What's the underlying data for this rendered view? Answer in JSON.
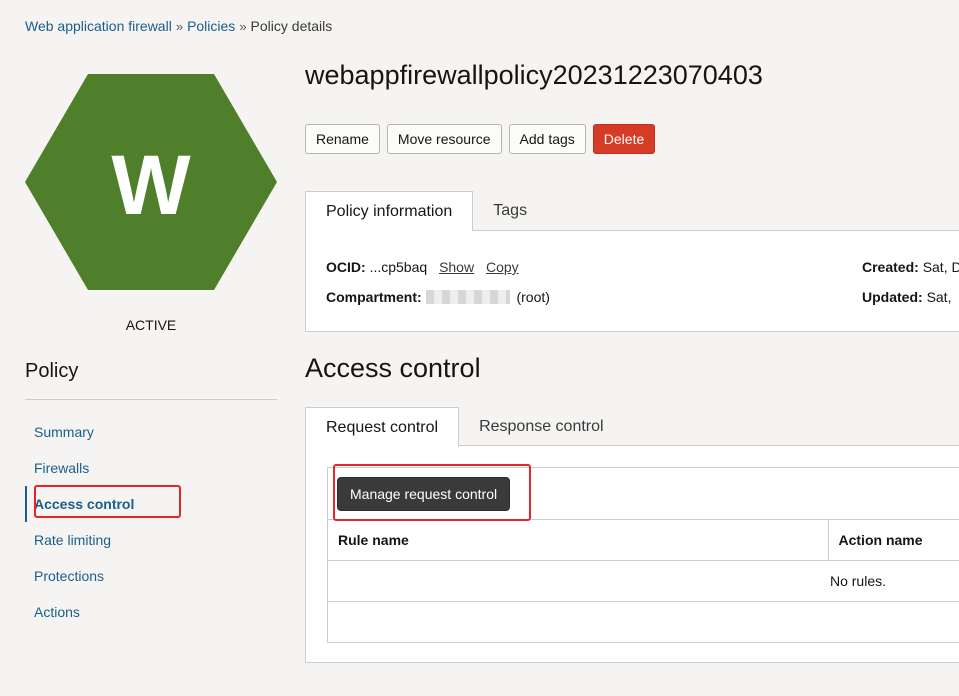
{
  "breadcrumb": {
    "items": [
      "Web application firewall",
      "Policies"
    ],
    "current": "Policy details",
    "separator": "»"
  },
  "resource": {
    "icon_letter": "W",
    "icon_color": "#4f7f2a",
    "status": "ACTIVE"
  },
  "sidebar": {
    "heading": "Policy",
    "items": [
      {
        "label": "Summary"
      },
      {
        "label": "Firewalls"
      },
      {
        "label": "Access control",
        "active": true
      },
      {
        "label": "Rate limiting"
      },
      {
        "label": "Protections"
      },
      {
        "label": "Actions"
      }
    ]
  },
  "page": {
    "title": "webappfirewallpolicy20231223070403"
  },
  "actions": {
    "rename": "Rename",
    "move": "Move resource",
    "add_tags": "Add tags",
    "delete": "Delete"
  },
  "info_tabs": [
    "Policy information",
    "Tags"
  ],
  "info": {
    "ocid_label": "OCID:",
    "ocid_value": "...cp5baq",
    "show": "Show",
    "copy": "Copy",
    "compartment_label": "Compartment:",
    "compartment_suffix": "(root)",
    "created_label": "Created:",
    "created_value": "Sat, D",
    "updated_label": "Updated:",
    "updated_value": "Sat,"
  },
  "access": {
    "title": "Access control",
    "tabs": [
      "Request control",
      "Response control"
    ],
    "manage_button": "Manage request control",
    "columns": [
      "Rule name",
      "Action name"
    ],
    "empty": "No rules."
  },
  "colors": {
    "accent": "#1a5e8a",
    "danger": "#d63b25",
    "highlight": "#e4252a"
  }
}
